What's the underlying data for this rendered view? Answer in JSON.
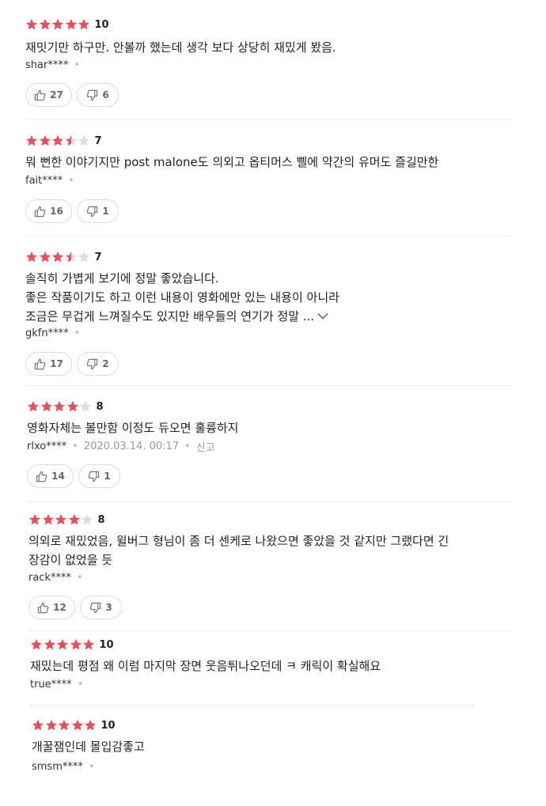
{
  "colors": {
    "star_filled": "#ea4d5b",
    "star_empty": "#dddddd",
    "divider": "#ededed",
    "meta_gray": "#9a9a9a"
  },
  "icons": {
    "like": "thumbs-up-icon",
    "dislike": "thumbs-down-icon",
    "star": "star-icon",
    "expand": "chevron-down-icon"
  },
  "reviews": [
    {
      "stars": 5,
      "score": "10",
      "comment": [
        "재밋기만 하구만. 안볼까 했는데 생각 보다 상당히 재밌게 봤음."
      ],
      "user": "shar****",
      "date": "",
      "report": "",
      "likes": "27",
      "dislikes": "6"
    },
    {
      "stars": 3.5,
      "score": "7",
      "comment": [
        "뭐 뻔한 이야기지만 post malone도 의외고 옵티머스 삘에 약간의 유머도 즐길만한"
      ],
      "user": "fait****",
      "date": "",
      "report": "",
      "likes": "16",
      "dislikes": "1"
    },
    {
      "stars": 3.5,
      "score": "7",
      "comment": [
        "솔직히 가볍게 보기에 정말 좋았습니다.",
        "좋은 작품이기도 하고 이런 내용이 영화에만 있는 내용이 아니라",
        "조금은 무겁게 느껴질수도 있지만 배우들의 연기가 정말 ..."
      ],
      "truncated": true,
      "user": "gkfn****",
      "date": "",
      "report": "",
      "likes": "17",
      "dislikes": "2"
    },
    {
      "stars": 4,
      "score": "8",
      "comment": [
        "영화자체는 볼만함 이정도 듀오면 훌륭하지"
      ],
      "user": "rlxo****",
      "date": "2020.03.14. 00:17",
      "report": "신고",
      "likes": "14",
      "dislikes": "1"
    },
    {
      "stars": 4,
      "score": "8",
      "comment": [
        "의외로 재밌었음, 윌버그 형님이 좀 더 센케로 나왔으면 좋았을 것 같지만 그랬다면 긴",
        "장감이 없었을 듯"
      ],
      "user": "rack****",
      "date": "",
      "report": "",
      "likes": "12",
      "dislikes": "3"
    },
    {
      "stars": 5,
      "score": "10",
      "comment": [
        "재밌는데 평점 왜 이럼 마지막 장면 웃음튀나오던데 ㅋ 캐릭이 확실해요"
      ],
      "user": "true****",
      "date": "",
      "report": "",
      "likes": "",
      "dislikes": ""
    },
    {
      "stars": 5,
      "score": "10",
      "comment": [
        "개꿀잼인데 몰입감좋고"
      ],
      "user": "smsm****",
      "date": "",
      "report": "",
      "likes": "",
      "dislikes": ""
    }
  ]
}
